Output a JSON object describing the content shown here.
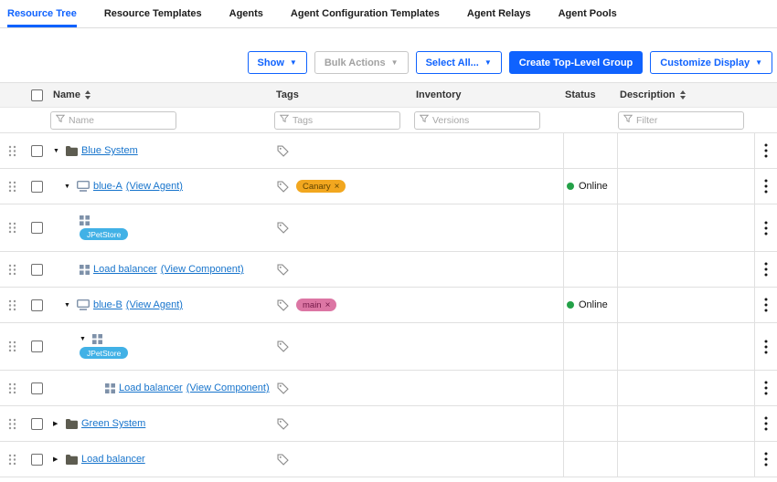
{
  "colors": {
    "accent_blue": "#0f62fe",
    "link_blue": "#1774cc",
    "online_green": "#24a148",
    "header_bg": "#f4f4f4",
    "row_border": "#e0e0e0"
  },
  "tabs": [
    {
      "label": "Resource Tree",
      "active": true
    },
    {
      "label": "Resource Templates",
      "active": false
    },
    {
      "label": "Agents",
      "active": false
    },
    {
      "label": "Agent Configuration Templates",
      "active": false
    },
    {
      "label": "Agent Relays",
      "active": false
    },
    {
      "label": "Agent Pools",
      "active": false
    }
  ],
  "toolbar": {
    "buttons": [
      {
        "label": "Show",
        "dropdown": true,
        "style": "outline"
      },
      {
        "label": "Bulk Actions",
        "dropdown": true,
        "style": "disabled"
      },
      {
        "label": "Select All...",
        "dropdown": true,
        "style": "outline"
      },
      {
        "label": "Create Top-Level Group",
        "dropdown": false,
        "style": "primary"
      },
      {
        "label": "Customize Display",
        "dropdown": true,
        "style": "outline"
      }
    ]
  },
  "table": {
    "headers": [
      {
        "label": "Name",
        "sortable": true
      },
      {
        "label": "Tags",
        "sortable": false
      },
      {
        "label": "Inventory",
        "sortable": false
      },
      {
        "label": "Status",
        "sortable": false
      },
      {
        "label": "Description",
        "sortable": true
      }
    ],
    "filters": {
      "name": "Name",
      "tags": "Tags",
      "inventory": "Versions",
      "description": "Filter"
    },
    "rows": [
      {
        "kind": "group",
        "icon": "folder",
        "arrow": "expanded",
        "indent": 0,
        "name": "Blue System"
      },
      {
        "kind": "agent",
        "icon": "agent",
        "arrow": "expanded",
        "indent": 1,
        "name": "blue-A",
        "view": "(View Agent)",
        "tag_badges": [
          {
            "label": "Canary",
            "bg": "#f2a71f",
            "fg": "#5f4300"
          }
        ],
        "status": "Online"
      },
      {
        "kind": "component",
        "icon": "grid",
        "indent": 2,
        "pill": "JPetStore"
      },
      {
        "kind": "leaf",
        "icon": "grid",
        "indent": 2,
        "name": "Load balancer",
        "view": "(View Component)"
      },
      {
        "kind": "agent",
        "icon": "agent",
        "arrow": "expanded",
        "indent": 1,
        "name": "blue-B",
        "view": "(View Agent)",
        "tag_badges": [
          {
            "label": "main",
            "bg": "#dc76a4",
            "fg": "#731747"
          }
        ],
        "status": "Online"
      },
      {
        "kind": "component",
        "icon": "grid",
        "arrow": "expanded",
        "indent": 2,
        "pill": "JPetStore"
      },
      {
        "kind": "leaf",
        "icon": "grid",
        "indent": 3,
        "name": "Load balancer",
        "view": "(View Component)"
      },
      {
        "kind": "group",
        "icon": "folder",
        "arrow": "collapsed",
        "indent": 0,
        "name": "Green System"
      },
      {
        "kind": "group",
        "icon": "folder",
        "arrow": "collapsed",
        "indent": 0,
        "name": "Load balancer"
      }
    ],
    "pill_bg": "#41b1e6"
  }
}
